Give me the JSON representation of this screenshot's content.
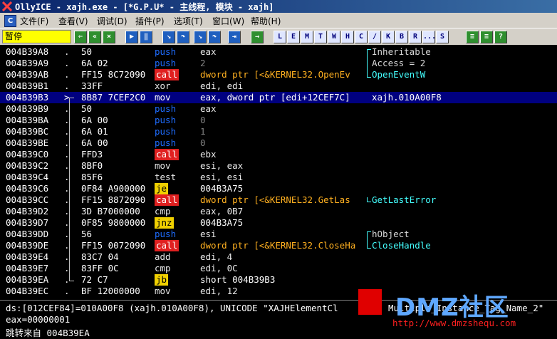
{
  "window": {
    "title": "OllyICE - xajh.exe - [*G.P.U* -  主线程, 模块 - xajh]"
  },
  "menu": [
    "文件(F)",
    "查看(V)",
    "调试(D)",
    "插件(P)",
    "选项(T)",
    "窗口(W)",
    "帮助(H)"
  ],
  "toolbar": {
    "status": "暂停",
    "buttons": [
      "open",
      "restart",
      "close",
      "run",
      "pause",
      "step-into",
      "step-over",
      "trace-into",
      "trace-over",
      "execute-till-return",
      "goto"
    ],
    "letters": [
      "L",
      "E",
      "M",
      "T",
      "W",
      "H",
      "C",
      "/",
      "K",
      "B",
      "R",
      "...",
      "S"
    ]
  },
  "rows": [
    {
      "addr": "004B39A8",
      "mark": ".",
      "hex": "50",
      "mn": "push",
      "op": "eax",
      "cm": "Inheritable",
      "kind": "push",
      "opkind": ""
    },
    {
      "addr": "004B39A9",
      "mark": ".",
      "hex": "6A 02",
      "mn": "push",
      "op": "2",
      "cm": "Access = 2",
      "kind": "push",
      "opkind": "num"
    },
    {
      "addr": "004B39AB",
      "mark": ".",
      "hex": "FF15 8C72090",
      "mn": "call",
      "op": "dword ptr [<&KERNEL32.OpenEv",
      "cm": "OpenEventW",
      "kind": "call",
      "opkind": "callop"
    },
    {
      "addr": "004B39B1",
      "mark": ".",
      "hex": "33FF",
      "mn": "xor",
      "op": "edi, edi",
      "cm": "",
      "kind": "plain",
      "opkind": ""
    },
    {
      "addr": "004B39B3",
      "mark": ">",
      "hex": "8B87 7CEF2C0",
      "mn": "mov",
      "op": "eax, dword ptr [edi+12CEF7C]",
      "cm": "xajh.010A00F8",
      "kind": "plain",
      "opkind": "",
      "sel": true
    },
    {
      "addr": "004B39B9",
      "mark": ".",
      "hex": "50",
      "mn": "push",
      "op": "eax",
      "cm": "",
      "kind": "push",
      "opkind": ""
    },
    {
      "addr": "004B39BA",
      "mark": ".",
      "hex": "6A 00",
      "mn": "push",
      "op": "0",
      "cm": "",
      "kind": "push",
      "opkind": "num"
    },
    {
      "addr": "004B39BC",
      "mark": ".",
      "hex": "6A 01",
      "mn": "push",
      "op": "1",
      "cm": "",
      "kind": "push",
      "opkind": "num"
    },
    {
      "addr": "004B39BE",
      "mark": ".",
      "hex": "6A 00",
      "mn": "push",
      "op": "0",
      "cm": "",
      "kind": "push",
      "opkind": "num"
    },
    {
      "addr": "004B39C0",
      "mark": ".",
      "hex": "FFD3",
      "mn": "call",
      "op": "ebx",
      "cm": "",
      "kind": "call",
      "opkind": ""
    },
    {
      "addr": "004B39C2",
      "mark": ".",
      "hex": "8BF0",
      "mn": "mov",
      "op": "esi, eax",
      "cm": "",
      "kind": "plain",
      "opkind": ""
    },
    {
      "addr": "004B39C4",
      "mark": ".",
      "hex": "85F6",
      "mn": "test",
      "op": "esi, esi",
      "cm": "",
      "kind": "plain",
      "opkind": ""
    },
    {
      "addr": "004B39C6",
      "mark": ".",
      "hex": "0F84 A900000",
      "mn": "je",
      "op": "004B3A75",
      "cm": "",
      "kind": "jmp",
      "opkind": "jop"
    },
    {
      "addr": "004B39CC",
      "mark": ".",
      "hex": "FF15 8872090",
      "mn": "call",
      "op": "dword ptr [<&KERNEL32.GetLas",
      "cm": "GetLastError",
      "kind": "call",
      "opkind": "callop"
    },
    {
      "addr": "004B39D2",
      "mark": ".",
      "hex": "3D B7000000",
      "mn": "cmp",
      "op": "eax, 0B7",
      "cm": "",
      "kind": "plain",
      "opkind": ""
    },
    {
      "addr": "004B39D7",
      "mark": ".",
      "hex": "0F85 9800000",
      "mn": "jnz",
      "op": "004B3A75",
      "cm": "",
      "kind": "jmp",
      "opkind": "jop"
    },
    {
      "addr": "004B39DD",
      "mark": ".",
      "hex": "56",
      "mn": "push",
      "op": "esi",
      "cm": "hObject",
      "kind": "push",
      "opkind": ""
    },
    {
      "addr": "004B39DE",
      "mark": ".",
      "hex": "FF15 0072090",
      "mn": "call",
      "op": "dword ptr [<&KERNEL32.CloseHa",
      "cm": "CloseHandle",
      "kind": "call",
      "opkind": "callop"
    },
    {
      "addr": "004B39E4",
      "mark": ".",
      "hex": "83C7 04",
      "mn": "add",
      "op": "edi, 4",
      "cm": "",
      "kind": "plain",
      "opkind": ""
    },
    {
      "addr": "004B39E7",
      "mark": ".",
      "hex": "83FF 0C",
      "mn": "cmp",
      "op": "edi, 0C",
      "cm": "",
      "kind": "plain",
      "opkind": ""
    },
    {
      "addr": "004B39EA",
      "mark": ".",
      "hex": "72 C7",
      "mn": "jb",
      "op": "short 004B39B3",
      "cm": "",
      "kind": "jmp",
      "opkind": "jop"
    },
    {
      "addr": "004B39EC",
      "mark": ".",
      "hex": "BF 12000000",
      "mn": "mov",
      "op": "edi, 12",
      "cm": "",
      "kind": "plain",
      "opkind": ""
    }
  ],
  "info": {
    "line1": "ds:[012CEF84]=010A00F8 (xajh.010A00F8), UNICODE \"XAJHElementCl",
    "line1_tail": "Multiple_Instance_Tag_Name_2\"",
    "line2": "eax=00000001",
    "line3": "跳转来自 004B39EA"
  },
  "watermark": {
    "brand": "DMZ社区",
    "url": "http://www.dmzshequ.com"
  },
  "colors": {
    "title_bg": "#0a246a",
    "selection": "#000080",
    "call_bg": "#e02020",
    "jump_bg": "#f0d000",
    "push_fg": "#1e6cff",
    "api_fg": "#44ffff"
  }
}
